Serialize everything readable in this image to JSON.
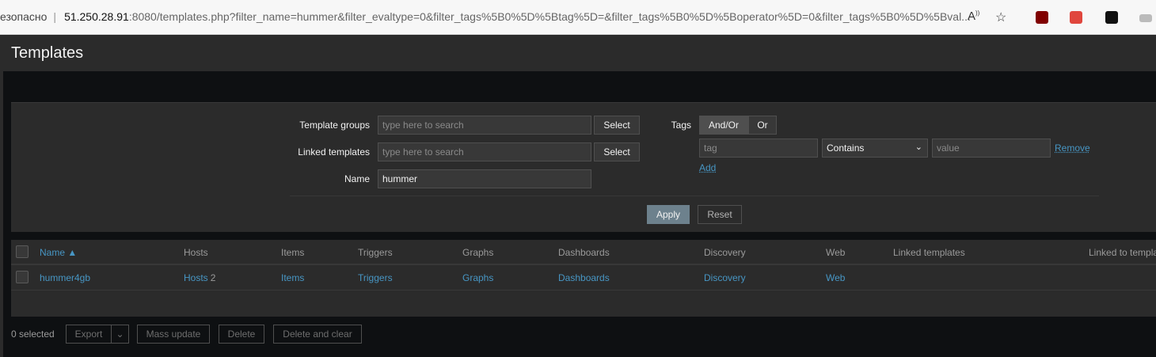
{
  "browser": {
    "insecure_label": "езопасно",
    "url_host": "51.250.28.91",
    "url_rest": ":8080/templates.php?filter_name=hummer&filter_evaltype=0&filter_tags%5B0%5D%5Btag%5D=&filter_tags%5B0%5D%5Boperator%5D=0&filter_tags%5B0%5D%5Bval..."
  },
  "header": {
    "title": "Templates"
  },
  "filter": {
    "template_groups_label": "Template groups",
    "template_groups_placeholder": "type here to search",
    "linked_templates_label": "Linked templates",
    "linked_templates_placeholder": "type here to search",
    "select_label": "Select",
    "name_label": "Name",
    "name_value": "hummer",
    "tags_label": "Tags",
    "tags_andor": "And/Or",
    "tags_or": "Or",
    "tag_placeholder": "tag",
    "operator_value": "Contains",
    "value_placeholder": "value",
    "remove_label": "Remove",
    "add_label": "Add",
    "apply_label": "Apply",
    "reset_label": "Reset"
  },
  "table": {
    "headers": {
      "name": "Name ▲",
      "hosts": "Hosts",
      "items": "Items",
      "triggers": "Triggers",
      "graphs": "Graphs",
      "dashboards": "Dashboards",
      "discovery": "Discovery",
      "web": "Web",
      "linked_templates": "Linked templates",
      "linked_to_templates": "Linked to templa"
    },
    "rows": [
      {
        "name": "hummer4gb",
        "hosts": "Hosts",
        "hosts_count": "2",
        "items": "Items",
        "triggers": "Triggers",
        "graphs": "Graphs",
        "dashboards": "Dashboards",
        "discovery": "Discovery",
        "web": "Web"
      }
    ]
  },
  "footer": {
    "selected": "0 selected",
    "export": "Export",
    "mass_update": "Mass update",
    "delete": "Delete",
    "delete_and_clear": "Delete and clear"
  },
  "colors": {
    "accent": "#4796c4",
    "background": "#0e1012",
    "panel": "#2b2b2b",
    "apply": "#6d818d"
  }
}
